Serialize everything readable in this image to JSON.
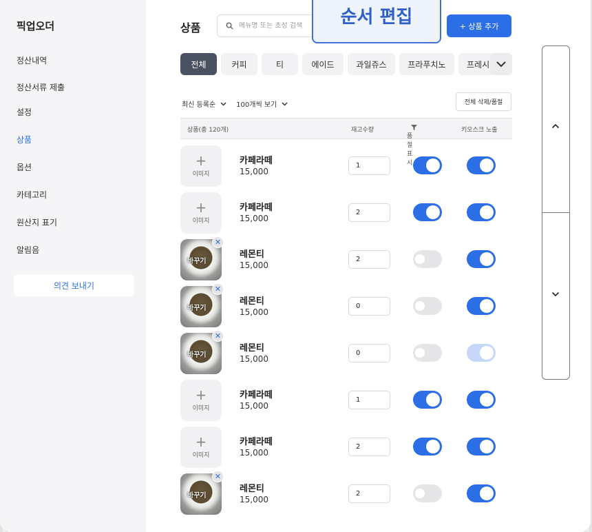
{
  "sidebar": {
    "brand": "픽업오더",
    "items": [
      {
        "label": "정산내역"
      },
      {
        "label": "정산서류 제출"
      },
      {
        "label": "설정"
      },
      {
        "label": "상품"
      },
      {
        "label": "옵션"
      },
      {
        "label": "카테고리"
      },
      {
        "label": "원산지 표기"
      },
      {
        "label": "알림음"
      }
    ],
    "active_item": "상품",
    "feedback_label": "의견 보내기"
  },
  "header": {
    "title": "상품",
    "search_placeholder": "메뉴명 또는 초성 검색",
    "order_edit_label": "순서 편집",
    "add_label": "+ 상품 추가"
  },
  "tabs": [
    {
      "label": "전체",
      "active": true
    },
    {
      "label": "커피"
    },
    {
      "label": "티"
    },
    {
      "label": "에이드"
    },
    {
      "label": "과일쥬스"
    },
    {
      "label": "프라푸치노"
    },
    {
      "label": "프레시"
    }
  ],
  "filters": {
    "sort_label": "최신 등록순",
    "page_size_label": "100개씩 보기",
    "bulk_label": "전체 삭제/품절"
  },
  "table": {
    "columns": {
      "product": "상품(총 120개)",
      "stock": "재고수량",
      "soldout": "품절표시",
      "kiosk": "키오스크 노출"
    },
    "rows": [
      {
        "name": "카페라떼",
        "price": "15,000",
        "image": "placeholder",
        "stock": "1",
        "soldout": "on",
        "kiosk": "on"
      },
      {
        "name": "카페라떼",
        "price": "15,000",
        "image": "placeholder",
        "stock": "2",
        "soldout": "on",
        "kiosk": "on"
      },
      {
        "name": "레몬티",
        "price": "15,000",
        "image": "photo",
        "stock": "2",
        "soldout": "off",
        "kiosk": "on"
      },
      {
        "name": "레몬티",
        "price": "15,000",
        "image": "photo",
        "stock": "0",
        "soldout": "off",
        "kiosk": "on"
      },
      {
        "name": "레몬티",
        "price": "15,000",
        "image": "photo",
        "stock": "0",
        "soldout": "off",
        "kiosk": "disabled"
      },
      {
        "name": "카페라떼",
        "price": "15,000",
        "image": "placeholder",
        "stock": "1",
        "soldout": "on",
        "kiosk": "on"
      },
      {
        "name": "카페라떼",
        "price": "15,000",
        "image": "placeholder",
        "stock": "2",
        "soldout": "on",
        "kiosk": "on"
      },
      {
        "name": "레몬티",
        "price": "15,000",
        "image": "photo",
        "stock": "2",
        "soldout": "off",
        "kiosk": "on"
      }
    ],
    "image_placeholder_label": "이미지",
    "image_swap_label": "바꾸기"
  },
  "icons": {
    "search": "search-icon",
    "more_tabs": "chevron-down-icon",
    "filter": "filter-icon",
    "remove": "close-icon",
    "scroll_up": "chevron-up-icon",
    "scroll_down": "chevron-down-icon"
  },
  "colors": {
    "accent": "#2b6ee6",
    "active_tab": "#4a5261",
    "toggle_off": "#e6e6e8",
    "toggle_disabled": "#c5d7fb"
  }
}
